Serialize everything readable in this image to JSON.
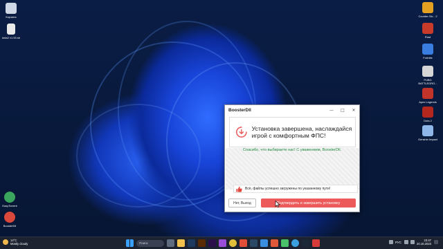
{
  "desktop": {
    "left_icons": [
      {
        "label": "Корзина",
        "icon": "recycle-bin-icon",
        "color": "#cfd8e6"
      },
      {
        "label": "dota2 v1.53.sb",
        "icon": "file-icon",
        "color": "#e9e9e9"
      },
      {
        "label": "EasyTorrent",
        "icon": "torrent-icon",
        "color": "#3aa55c"
      },
      {
        "label": "BoosterDll",
        "icon": "booster-icon",
        "color": "#d9483b"
      }
    ],
    "right_icons": [
      {
        "label": "Counter-Str... 2",
        "icon": "cs2-icon",
        "color": "#e4a121"
      },
      {
        "label": "Rust",
        "icon": "rust-icon",
        "color": "#c83a2a"
      },
      {
        "label": "Fortnite",
        "icon": "fortnite-icon",
        "color": "#3a7de0"
      },
      {
        "label": "PUBG BATTLEGRO...",
        "icon": "pubg-icon",
        "color": "#d6d6d6"
      },
      {
        "label": "Apex Legends",
        "icon": "apex-icon",
        "color": "#c2342a"
      },
      {
        "label": "Dota 2",
        "icon": "dota2-icon",
        "color": "#b3271f"
      },
      {
        "label": "Genshin Impact",
        "icon": "genshin-icon",
        "color": "#8fb6e8"
      }
    ]
  },
  "window": {
    "title": "BoosterDll",
    "controls": {
      "minimize": "—",
      "maximize": "□",
      "close": "✕"
    },
    "hero_text": "Установка завершена, наслаждайся игрой с комфортным ФПС!",
    "thanks": "Спасибо, что выбираете нас! С уважением, BoosterDll.",
    "notice": "Всё, файлы успешно загружены по указанному пути!",
    "btn_exit": "Нет, Выход",
    "btn_finish": "Подтвердить и завершить установку",
    "accent": "#ec5a5a",
    "success_color": "#1f8a3e"
  },
  "taskbar": {
    "weather_temp": "14°C",
    "weather_desc": "Mostly cloudy",
    "search_placeholder": "Поиск",
    "language": "РУС",
    "time": "23:47",
    "date": "20.10.2023"
  }
}
